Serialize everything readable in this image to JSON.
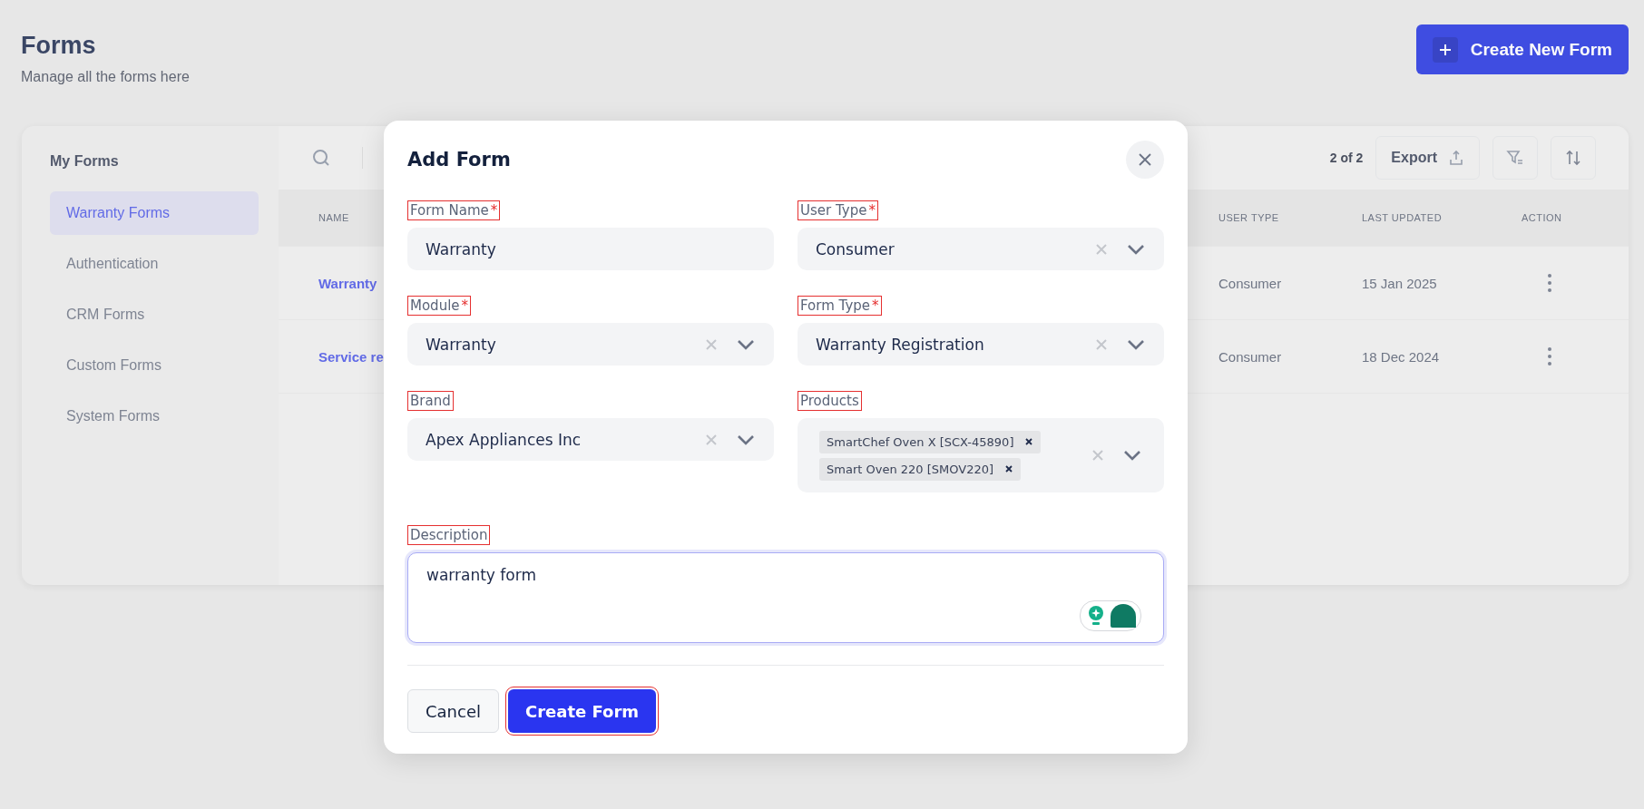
{
  "page": {
    "title": "Forms",
    "subtitle": "Manage all the forms here",
    "create_button": "Create New Form"
  },
  "sidebar": {
    "heading": "My Forms",
    "items": [
      {
        "label": "Warranty Forms",
        "selected": true
      },
      {
        "label": "Authentication",
        "selected": false
      },
      {
        "label": "CRM Forms",
        "selected": false
      },
      {
        "label": "Custom Forms",
        "selected": false
      },
      {
        "label": "System Forms",
        "selected": false
      }
    ]
  },
  "table": {
    "count": "2 of 2",
    "export_button": "Export",
    "columns": [
      "NAME",
      "USER TYPE",
      "LAST UPDATED",
      "ACTION"
    ],
    "rows": [
      {
        "name": "Warranty",
        "user_type": "Consumer",
        "last_updated": "15 Jan 2025"
      },
      {
        "name": "Service re",
        "user_type": "Consumer",
        "last_updated": "18 Dec 2024"
      }
    ]
  },
  "modal": {
    "title": "Add Form",
    "fields": [
      {
        "label": "Form Name",
        "required_mark": "*",
        "outlined": true,
        "kind": "text",
        "value": "Warranty"
      },
      {
        "label": "User Type",
        "required_mark": "*",
        "outlined": true,
        "kind": "select",
        "value": "Consumer"
      },
      {
        "label": "Module",
        "required_mark": "*",
        "outlined": true,
        "kind": "select",
        "value": "Warranty"
      },
      {
        "label": "Form Type",
        "required_mark": "*",
        "outlined": true,
        "kind": "select",
        "value": "Warranty Registration"
      },
      {
        "label": "Brand",
        "outlined": true,
        "kind": "select",
        "value": "Apex Appliances Inc"
      },
      {
        "label": "Products",
        "outlined": true,
        "kind": "multiselect",
        "tags": [
          "SmartChef Oven X [SCX-45890]",
          "Smart Oven 220 [SMOV220]"
        ]
      },
      {
        "label": "Description",
        "outlined": true,
        "kind": "textarea",
        "value": "warranty form"
      }
    ],
    "buttons": [
      {
        "label": "Cancel",
        "kind": "secondary",
        "outlined": false
      },
      {
        "label": "Create Form",
        "kind": "primary",
        "outlined": true
      }
    ]
  }
}
